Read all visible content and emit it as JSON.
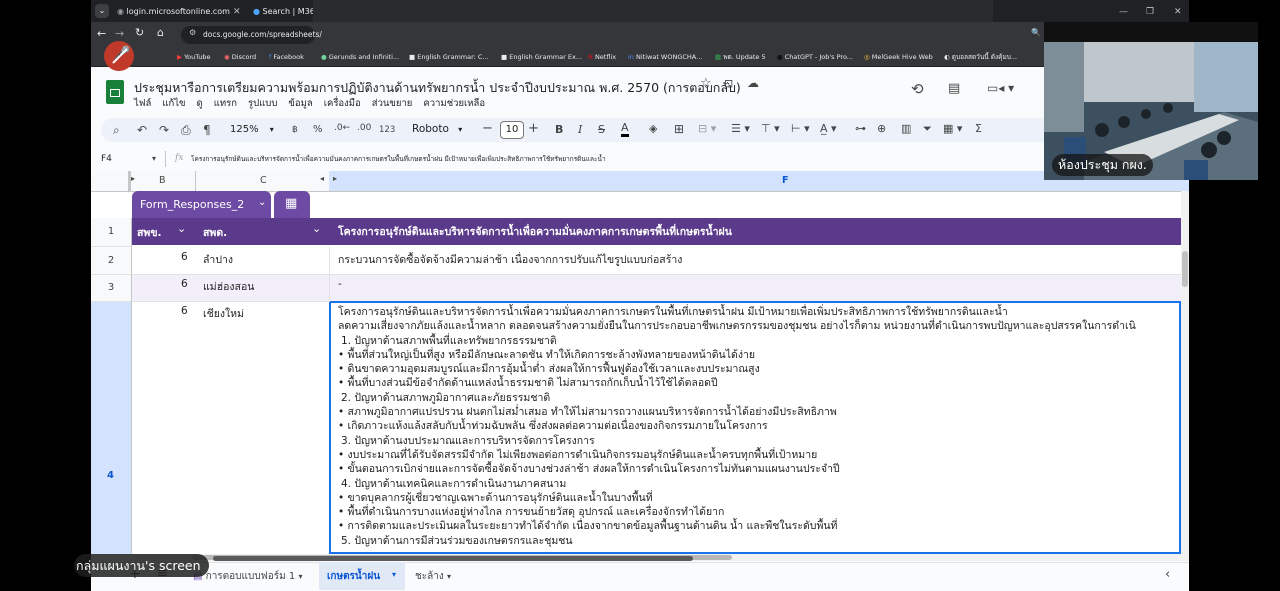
{
  "browser": {
    "tabs": [
      {
        "label": "login.microsoftonline.com"
      },
      {
        "label": "Search | M365"
      }
    ],
    "url": "docs.google.com/spreadsheets/",
    "bookmarks": [
      "YouTube",
      "Discord",
      "Facebook",
      "Gerunds and Infiniti...",
      "English Grammar: C...",
      "English Grammar Ex...",
      "Netflix",
      "Nitiwat WONGCHA...",
      "พด. Update 5",
      "ChatGPT - Job's Pro...",
      "MelGeek Hive Web",
      "ดูบอลสดวันนี้ ดังคุ้มบ..."
    ]
  },
  "doc": {
    "title": "ประชุมหารือการเตรียมความพร้อมการปฏิบัติงานด้านทรัพยากรน้ำ ประจำปีงบประมาณ พ.ศ. 2570 (การตอบกลับ)",
    "menu": [
      "ไฟล์",
      "แก้ไข",
      "ดู",
      "แทรก",
      "รูปแบบ",
      "ข้อมูล",
      "เครื่องมือ",
      "ส่วนขยาย",
      "ความช่วยเหลือ"
    ]
  },
  "toolbar": {
    "zoom": "125%",
    "percent": "%",
    "dec_decrease": ".0←",
    "dec_increase": ".00",
    "format_123": "123",
    "font": "Roboto",
    "font_size": "10",
    "bold": "B",
    "italic": "I",
    "sigma": "Σ"
  },
  "formula_bar": {
    "cell_ref": "F4",
    "fx": "fx",
    "content": "โครงการอนุรักษ์ดินและบริหารจัดการน้ำเพื่อความมั่นคงภาคการเกษตรในพื้นที่เกษตรน้ำฝน มีเป้าหมายเพื่อเพิ่มประสิทธิภาพการใช้ทรัพยากรดินและน้ำ"
  },
  "columns": [
    "B",
    "C",
    "F"
  ],
  "table_name": "Form_Responses_2",
  "header_row": {
    "num": "1",
    "col_b": "สพข.",
    "col_c": "สพด.",
    "col_f": "โครงการอนุรักษ์ดินและบริหารจัดการน้ำเพื่อความมั่นคงภาคการเกษตรพื้นที่เกษตรน้ำฝน"
  },
  "rows": [
    {
      "num": "2",
      "b": "6",
      "c": "ลำปาง",
      "f": "กระบวนการจัดซื้อจัดจ้างมีความล่าช้า เนื่องจากการปรับแก้ไขรูปแบบก่อสร้าง"
    },
    {
      "num": "3",
      "b": "6",
      "c": "แม่ฮ่องสอน",
      "f": "-"
    },
    {
      "num": "4",
      "b": "6",
      "c": "เชียงใหม่",
      "f_lines": [
        "โครงการอนุรักษ์ดินและบริหารจัดการน้ำเพื่อความมั่นคงภาคการเกษตรในพื้นที่เกษตรน้ำฝน มีเป้าหมายเพื่อเพิ่มประสิทธิภาพการใช้ทรัพยากรดินและน้ำ",
        "ลดความเสี่ยงจากภัยแล้งและน้ำหลาก ตลอดจนสร้างความยั่งยืนในการประกอบอาชีพเกษตรกรรมของชุมชน อย่างไรก็ตาม หน่วยงานที่ดำเนินการพบปัญหาและอุปสรรคในการดำเนิ",
        "1. ปัญหาด้านสภาพพื้นที่และทรัพยากรธรรมชาติ",
        "• พื้นที่ส่วนใหญ่เป็นที่สูง หรือมีลักษณะลาดชัน ทำให้เกิดการชะล้างพังทลายของหน้าดินได้ง่าย",
        "• ดินขาดความอุดมสมบูรณ์และมีการอุ้มน้ำต่ำ ส่งผลให้การฟื้นฟูต้องใช้เวลาและงบประมาณสูง",
        "• พื้นที่บางส่วนมีข้อจำกัดด้านแหล่งน้ำธรรมชาติ ไม่สามารถกักเก็บน้ำไว้ใช้ได้ตลอดปี",
        "2. ปัญหาด้านสภาพภูมิอากาศและภัยธรรมชาติ",
        "• สภาพภูมิอากาศแปรปรวน ฝนตกไม่สม่ำเสมอ ทำให้ไม่สามารถวางแผนบริหารจัดการน้ำได้อย่างมีประสิทธิภาพ",
        "• เกิดภาวะแห้งแล้งสลับกับน้ำท่วมฉับพลัน ซึ่งส่งผลต่อความต่อเนื่องของกิจกรรมภายในโครงการ",
        "3. ปัญหาด้านงบประมาณและการบริหารจัดการโครงการ",
        "• งบประมาณที่ได้รับจัดสรรมีจำกัด ไม่เพียงพอต่อการดำเนินกิจกรรมอนุรักษ์ดินและน้ำครบทุกพื้นที่เป้าหมาย",
        "• ขั้นตอนการเบิกจ่ายและการจัดซื้อจัดจ้างบางช่วงล่าช้า ส่งผลให้การดำเนินโครงการไม่ทันตามแผนงานประจำปี",
        "4. ปัญหาด้านเทคนิคและการดำเนินงานภาคสนาม",
        "• ขาดบุคลากรผู้เชี่ยวชาญเฉพาะด้านการอนุรักษ์ดินและน้ำในบางพื้นที่",
        "• พื้นที่ดำเนินการบางแห่งอยู่ห่างไกล การขนย้ายวัสดุ อุปกรณ์ และเครื่องจักรทำได้ยาก",
        "• การติดตามและประเมินผลในระยะยาวทำได้จำกัด เนื่องจากขาดข้อมูลพื้นฐานด้านดิน น้ำ และพืชในระดับพื้นที่",
        "5. ปัญหาด้านการมีส่วนร่วมของเกษตรกรและชุมชน"
      ]
    }
  ],
  "sheet_tabs": {
    "items": [
      "การตอบแบบฟอร์ม 1",
      "เกษตรน้ำฝน",
      "ชะล้าง"
    ],
    "active": 1
  },
  "meeting": {
    "room_label": "ห้องประชุม กผง.",
    "screen_share_label": "กลุ่มแผนงาน's screen"
  },
  "colors": {
    "header_purple": "#5b3a8c",
    "table_tab_purple": "#6d4aa3",
    "active_tab_blue": "#0b57d0",
    "sheets_green": "#188038"
  }
}
